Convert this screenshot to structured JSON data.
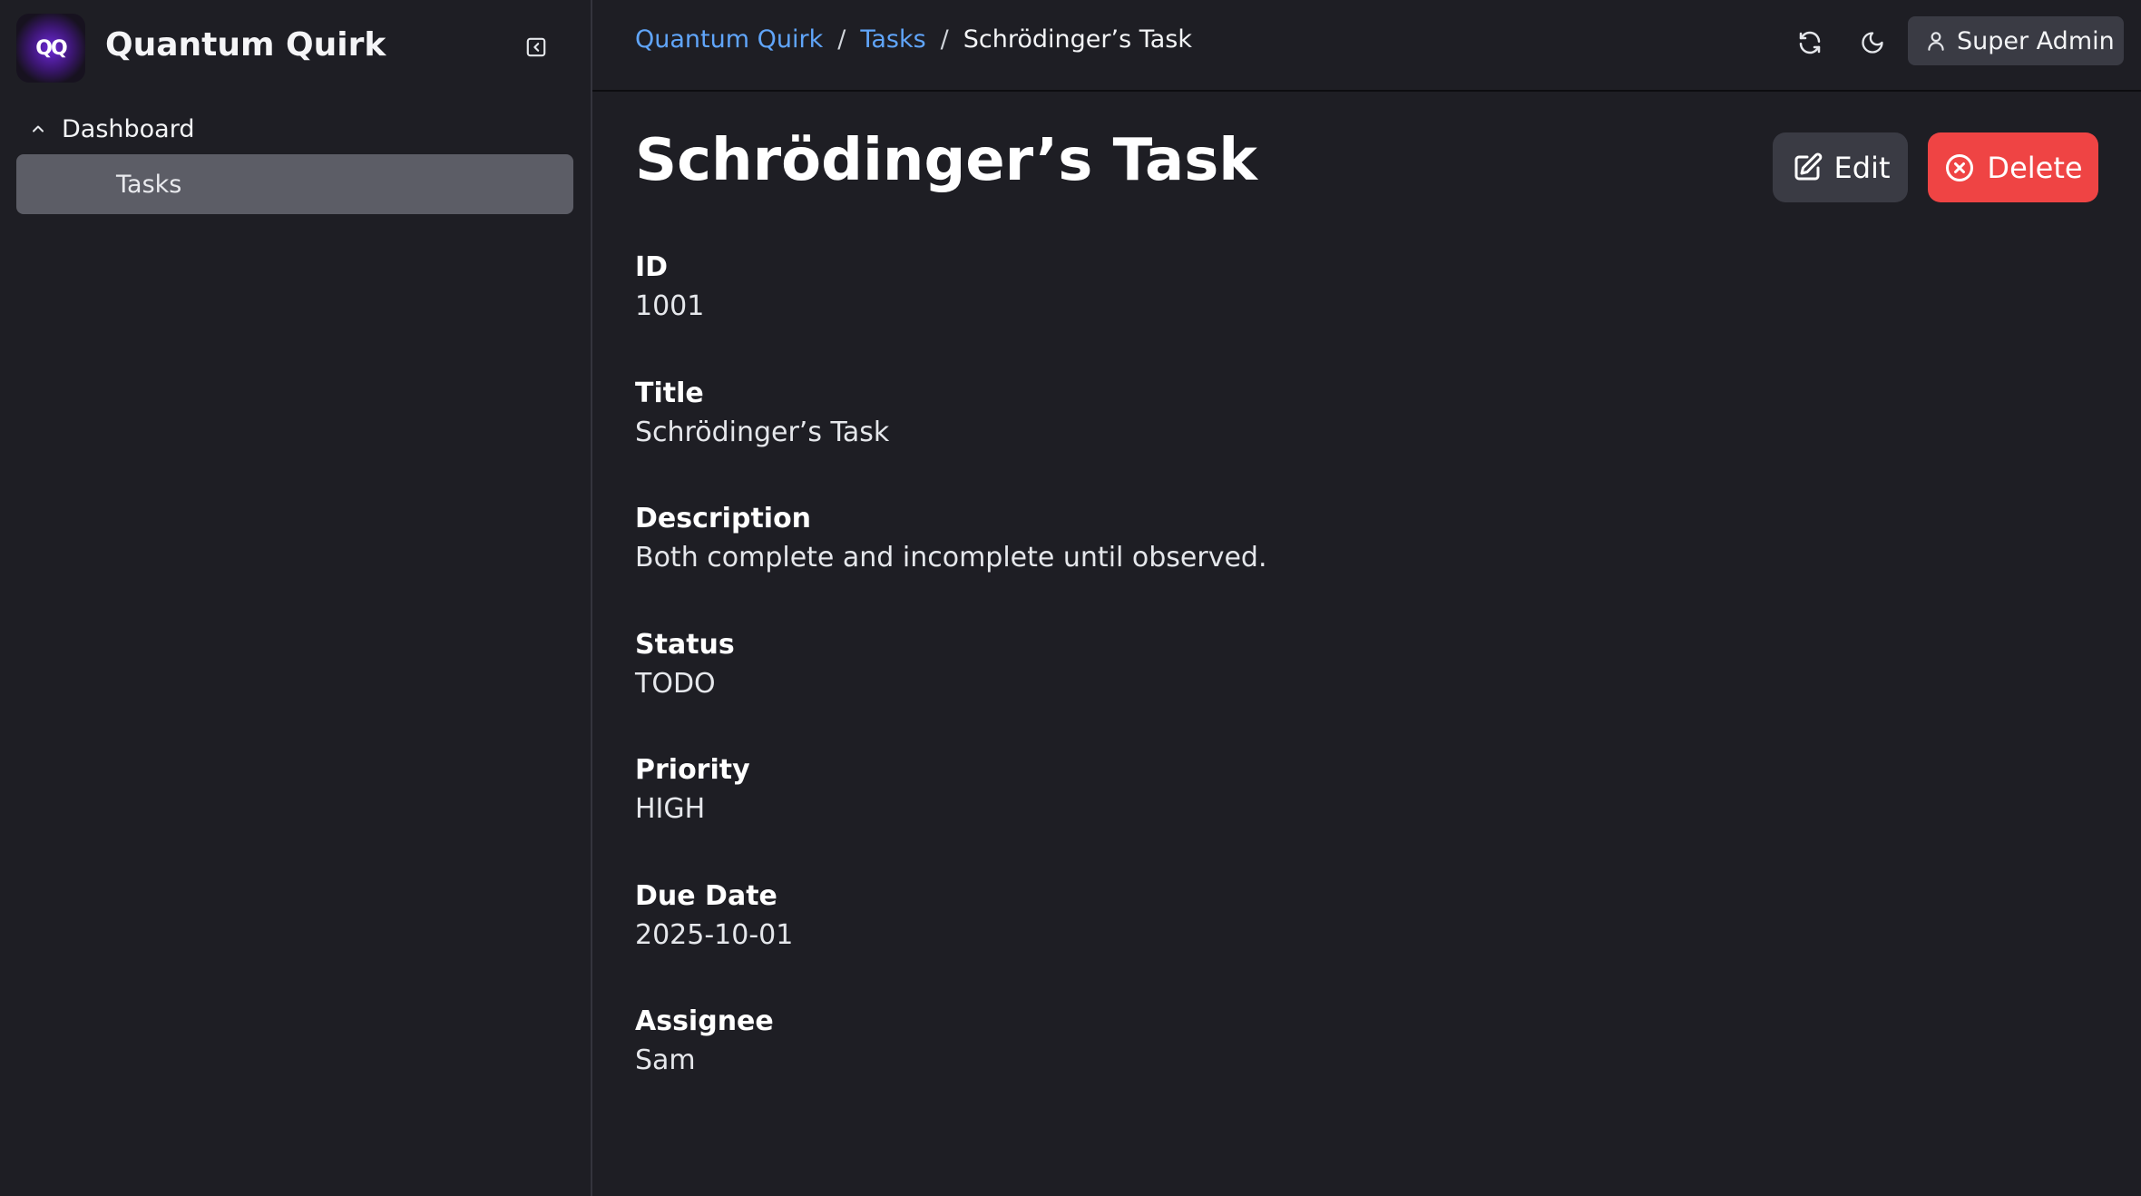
{
  "app": {
    "logo_text": "QQ",
    "name": "Quantum Quirk"
  },
  "sidebar": {
    "group": {
      "label": "Dashboard",
      "icon": "chevron-up-icon"
    },
    "items": [
      {
        "label": "Tasks",
        "active": true
      }
    ],
    "collapse_icon": "sidebar-collapse-icon"
  },
  "breadcrumb": {
    "items": [
      {
        "label": "Quantum Quirk"
      },
      {
        "label": "Tasks"
      }
    ],
    "separator": "/",
    "current": "Schrödinger’s Task"
  },
  "topbar": {
    "refresh_icon": "refresh-icon",
    "theme_icon": "moon-icon",
    "user": {
      "name": "Super Admin",
      "icon": "user-icon"
    }
  },
  "record": {
    "title": "Schrödinger’s Task",
    "actions": {
      "edit_label": "Edit",
      "delete_label": "Delete"
    },
    "fields": [
      {
        "label": "ID",
        "value": "1001"
      },
      {
        "label": "Title",
        "value": "Schrödinger’s Task"
      },
      {
        "label": "Description",
        "value": "Both complete and incomplete until observed."
      },
      {
        "label": "Status",
        "value": "TODO"
      },
      {
        "label": "Priority",
        "value": "HIGH"
      },
      {
        "label": "Due Date",
        "value": "2025-10-01"
      },
      {
        "label": "Assignee",
        "value": "Sam"
      }
    ]
  },
  "colors": {
    "background": "#1e1e24",
    "link": "#60a5fa",
    "danger": "#ef4444",
    "active_nav": "#5c5d66",
    "button_neutral": "#3a3b44"
  }
}
